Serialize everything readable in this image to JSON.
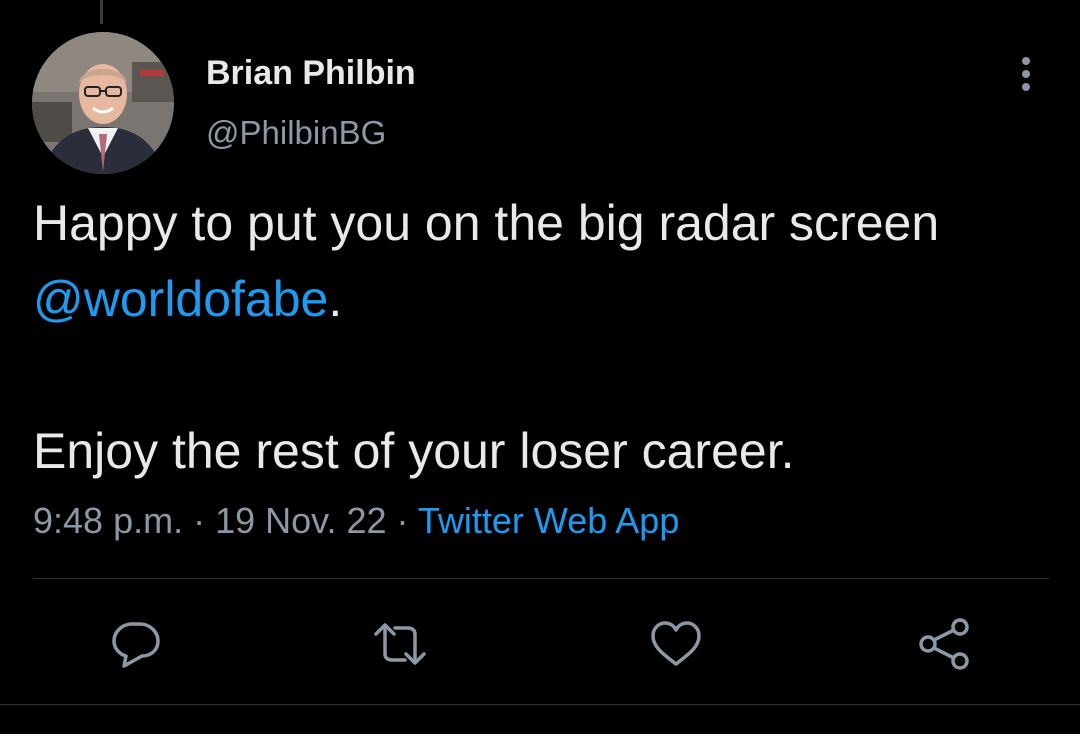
{
  "tweet": {
    "author": {
      "display_name": "Brian Philbin",
      "handle": "@PhilbinBG",
      "avatar_icon": "profile-photo"
    },
    "text": {
      "line1_prefix": "Happy to put you on the big radar screen ",
      "mention": "@worldofabe",
      "line1_suffix": ".",
      "line2": "Enjoy the rest of your loser career."
    },
    "meta": {
      "time": "9:48 p.m.",
      "separator": " · ",
      "date": "19 Nov. 22",
      "source": "Twitter Web App"
    },
    "actions": [
      {
        "name": "reply",
        "icon": "reply-icon"
      },
      {
        "name": "retweet",
        "icon": "retweet-icon"
      },
      {
        "name": "like",
        "icon": "heart-icon"
      },
      {
        "name": "share",
        "icon": "share-icon"
      }
    ],
    "more_icon": "more-options-icon"
  },
  "colors": {
    "background": "#000000",
    "text": "#e7e9ea",
    "secondary": "#8b98a5",
    "accent": "#1d9bf0",
    "icon": "#8b98a5",
    "divider": "#2f3336"
  }
}
